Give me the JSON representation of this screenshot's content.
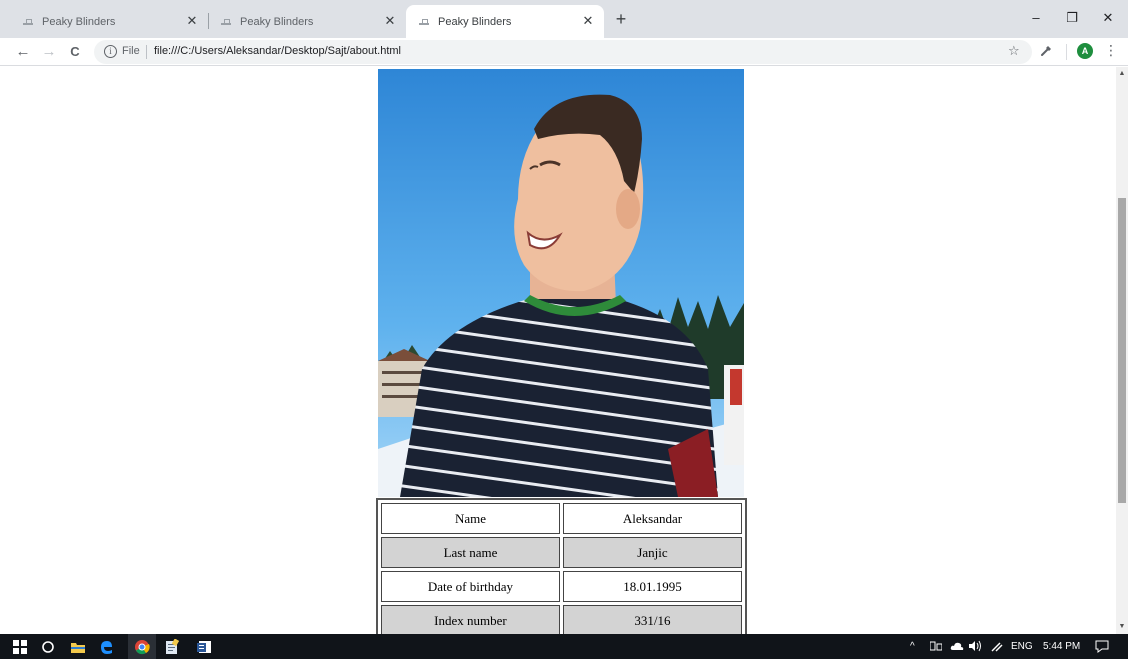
{
  "browser": {
    "tabs": [
      {
        "title": "Peaky Blinders",
        "active": false
      },
      {
        "title": "Peaky Blinders",
        "active": false
      },
      {
        "title": "Peaky Blinders",
        "active": true
      }
    ],
    "tab_close_glyph": "✕",
    "new_tab_glyph": "+",
    "window_controls": {
      "minimize": "–",
      "restore": "❐",
      "close": "✕"
    },
    "nav": {
      "back": "←",
      "forward": "→",
      "reload": "C"
    },
    "address": {
      "info": "i",
      "scheme_label": "File",
      "url": "file:///C:/Users/Aleksandar/Desktop/Sajt/about.html"
    },
    "bookmark_glyph": "☆",
    "profile_initial": "A",
    "menu_glyph": "⋮"
  },
  "page": {
    "profile_table": [
      {
        "label": "Name",
        "value": "Aleksandar"
      },
      {
        "label": "Last name",
        "value": "Janjic"
      },
      {
        "label": "Date of birthday",
        "value": "18.01.1995"
      },
      {
        "label": "Index number",
        "value": "331/16"
      }
    ]
  },
  "scrollbar": {
    "up": "▲",
    "down": "▼"
  },
  "taskbar": {
    "tray": {
      "chevron": "^",
      "language": "ENG",
      "time": "5:44 PM"
    }
  },
  "colors": {
    "tabstrip_bg": "#dee1e6",
    "omnibox_bg": "#f1f3f4",
    "table_row_shade": "#d3d3d3",
    "taskbar_bg": "#101419",
    "profile_badge": "#1e8e3e"
  }
}
